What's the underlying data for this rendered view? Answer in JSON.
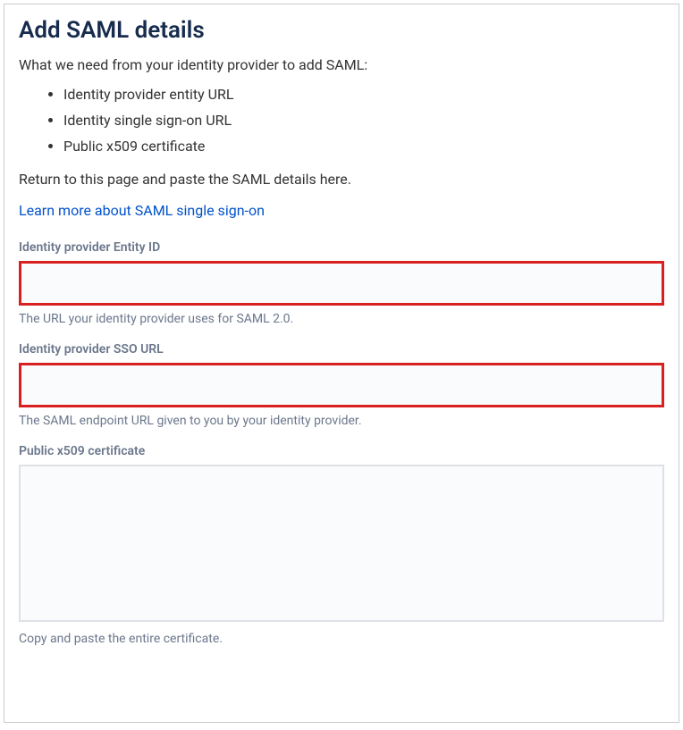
{
  "heading": "Add SAML details",
  "intro": "What we need from your identity provider to add SAML:",
  "bullets": [
    "Identity provider entity URL",
    "Identity single sign-on URL",
    "Public x509 certificate"
  ],
  "return_text": "Return to this page and paste the SAML details here.",
  "learn_link": "Learn more about SAML single sign-on",
  "fields": {
    "entity_id": {
      "label": "Identity provider Entity ID",
      "value": "",
      "helper": "The URL your identity provider uses for SAML 2.0."
    },
    "sso_url": {
      "label": "Identity provider SSO URL",
      "value": "",
      "helper": "The SAML endpoint URL given to you by your identity provider."
    },
    "certificate": {
      "label": "Public x509 certificate",
      "value": "",
      "helper": "Copy and paste the entire certificate."
    }
  }
}
